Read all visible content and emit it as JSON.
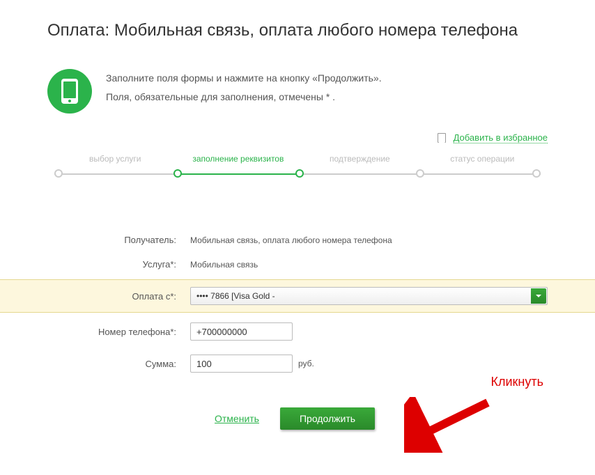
{
  "title": "Оплата: Мобильная связь, оплата любого номера телефона",
  "info": {
    "line1": "Заполните поля формы и нажмите на кнопку «Продолжить».",
    "line2": "Поля, обязательные для заполнения, отмечены * ."
  },
  "favorites": {
    "label": "Добавить в избранное"
  },
  "stepper": {
    "step1": "выбор услуги",
    "step2": "заполнение реквизитов",
    "step3": "подтверждение",
    "step4": "статус операции"
  },
  "form": {
    "recipient_label": "Получатель:",
    "recipient_value": "Мобильная связь, оплата любого номера телефона",
    "service_label": "Услуга*:",
    "service_value": "Мобильная связь",
    "payfrom_label": "Оплата с*:",
    "payfrom_value": "•••• 7866 [Visa Gold -",
    "phone_label": "Номер телефона*:",
    "phone_value": "+700000000",
    "amount_label": "Сумма:",
    "amount_value": "100",
    "currency": "руб."
  },
  "actions": {
    "cancel": "Отменить",
    "submit": "Продолжить"
  },
  "annotation": "Кликнуть"
}
